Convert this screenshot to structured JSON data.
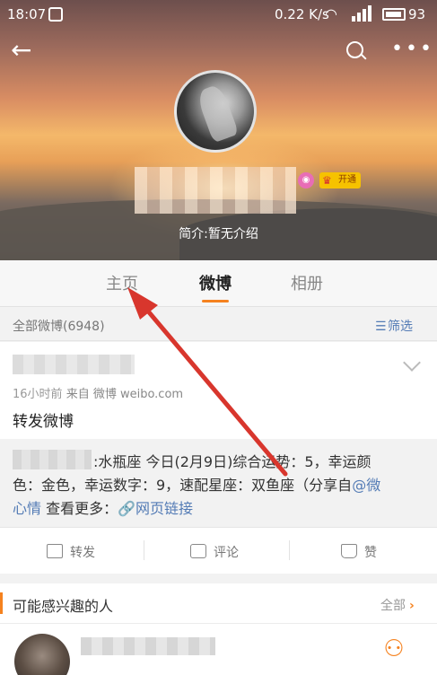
{
  "status_bar": {
    "time": "18:07",
    "speed": "0.22 K/s",
    "network": "4G",
    "battery": "93"
  },
  "profile": {
    "bio": "简介:暂无介绍",
    "badge_open": "开通"
  },
  "tabs": [
    {
      "label": "主页"
    },
    {
      "label": "微博"
    },
    {
      "label": "相册"
    }
  ],
  "feed": {
    "count_label": "全部微博(6948)",
    "filter_label": "筛选"
  },
  "post": {
    "meta_time": "16小时前",
    "meta_source": "来自 微博 weibo.com",
    "text": "转发微博",
    "repost_line1": ":水瓶座 今日(2月9日)综合运势：5，幸运颜",
    "repost_line2_a": "色：金色，幸运数字：9，速配星座：双鱼座（分享自",
    "repost_line2_link": "@微",
    "repost_line3_link1": "心情",
    "repost_line3_mid": " 查看更多：",
    "repost_line3_link2": "网页链接",
    "actions": {
      "repost": "转发",
      "comment": "评论",
      "like": "赞"
    }
  },
  "recommend": {
    "title": "可能感兴趣的人",
    "all_label": "全部"
  },
  "colors": {
    "accent": "#f5821f",
    "link": "#537bb5",
    "annotation_arrow": "#d8362d"
  }
}
